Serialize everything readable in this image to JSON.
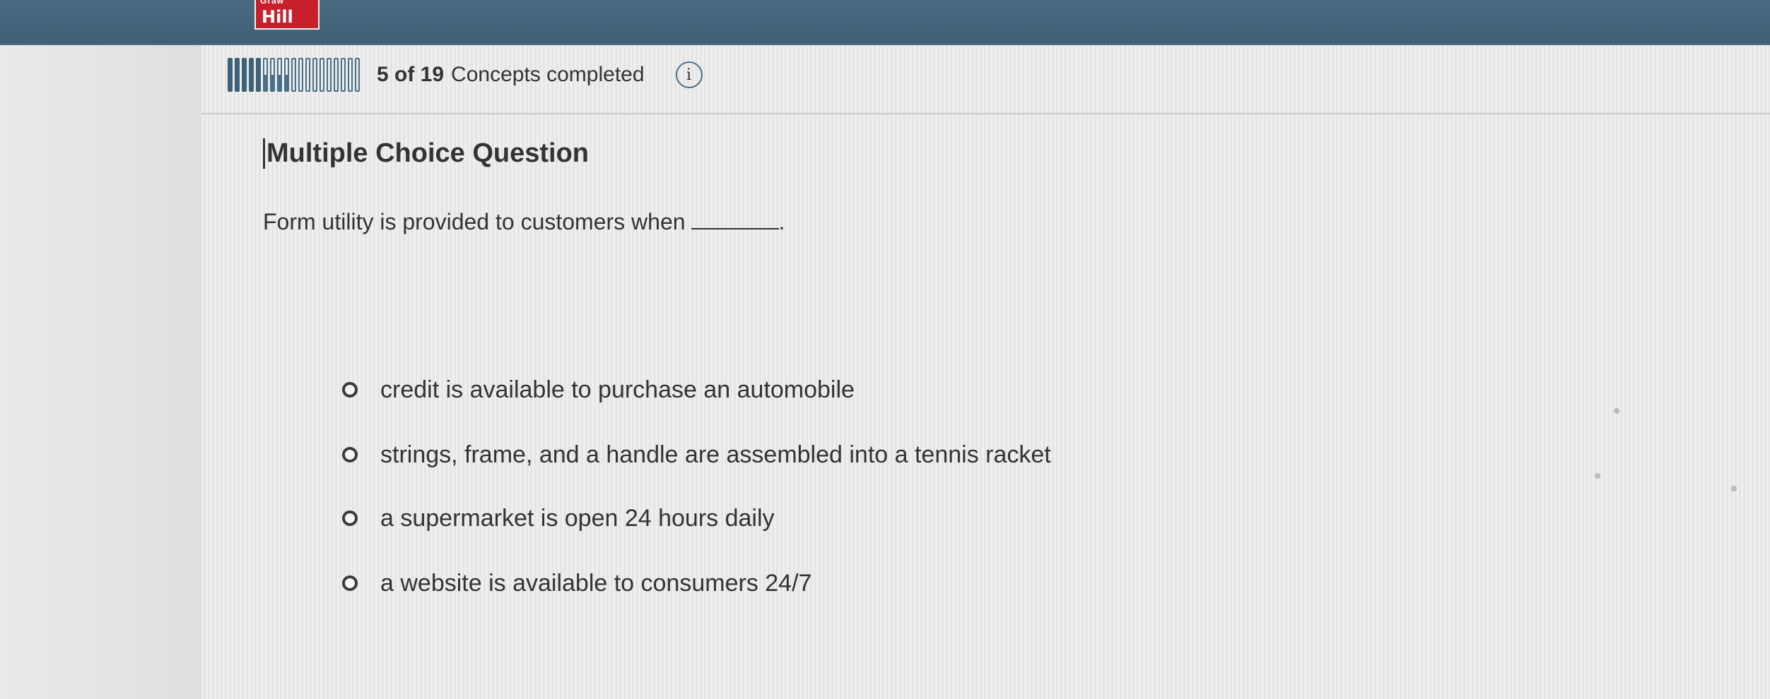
{
  "header": {
    "logo_top": "Graw",
    "logo_text": "Hill",
    "brand_color": "#3f6075",
    "logo_color": "#c8202b"
  },
  "progress": {
    "completed_count": "5 of 19",
    "suffix": "Concepts completed",
    "completed": 5,
    "total": 19,
    "info_icon": "info-icon"
  },
  "question": {
    "type_label": "Multiple Choice Question",
    "prompt": "Form utility is provided to customers when",
    "blank_suffix": ".",
    "options": [
      {
        "label": "credit is available to purchase an automobile"
      },
      {
        "label": "strings, frame, and a handle are assembled into a tennis racket"
      },
      {
        "label": "a supermarket is open 24 hours daily"
      },
      {
        "label": "a website is available to consumers 24/7"
      }
    ]
  }
}
